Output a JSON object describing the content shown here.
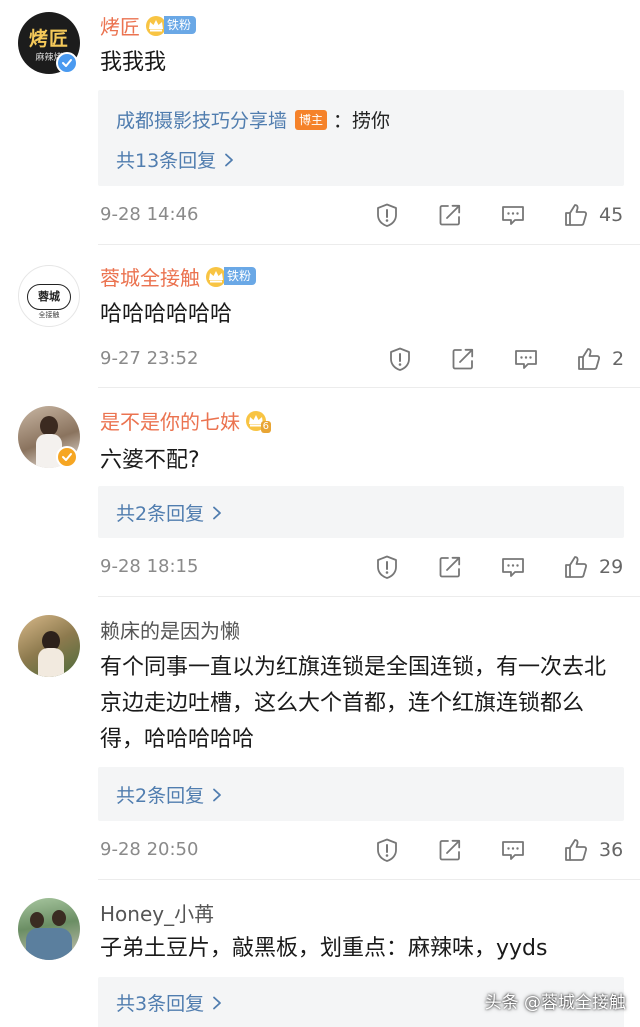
{
  "comments": [
    {
      "name": "烤匠",
      "fan_badge": "铁粉",
      "content": "我我我",
      "reply_preview": {
        "author": "成都摄影技巧分享墙",
        "tag": "博主",
        "text": "：捞你"
      },
      "more_replies": "共13条回复",
      "time": "9-28 14:46",
      "likes": "45",
      "avatar_text": [
        "烤匠",
        "麻辣烤"
      ]
    },
    {
      "name": "蓉城全接触",
      "fan_badge": "铁粉",
      "content": "哈哈哈哈哈哈",
      "time": "9-27 23:52",
      "likes": "2",
      "avatar_text": [
        "蓉城",
        "全接触"
      ]
    },
    {
      "name": "是不是你的七妹",
      "fan_badge": "6",
      "content": "六婆不配?",
      "more_replies": "共2条回复",
      "time": "9-28 18:15",
      "likes": "29"
    },
    {
      "name": "赖床的是因为懒",
      "content": "有个同事一直以为红旗连锁是全国连锁，有一次去北京边走边吐槽，这么大个首都，连个红旗连锁都么得，哈哈哈哈哈",
      "more_replies": "共2条回复",
      "time": "9-28 20:50",
      "likes": "36"
    },
    {
      "name": "Honey_小苒",
      "content": "子弟土豆片，敲黑板，划重点：麻辣味，yyds",
      "more_replies": "共3条回复"
    }
  ],
  "watermark": "头条 @蓉城全接触",
  "icons": [
    "report-icon",
    "repost-icon",
    "comment-icon",
    "like-icon",
    "chevron-right-icon",
    "verified-icon",
    "crown-icon"
  ],
  "colors": {
    "username": "#eb7350",
    "link": "#507daf",
    "meta": "#8a8a8a",
    "host_tag": "#f5822a",
    "fan_tag": "#6aa8e6",
    "verified": "#f6a623",
    "reply_bg": "#f4f5f6"
  }
}
